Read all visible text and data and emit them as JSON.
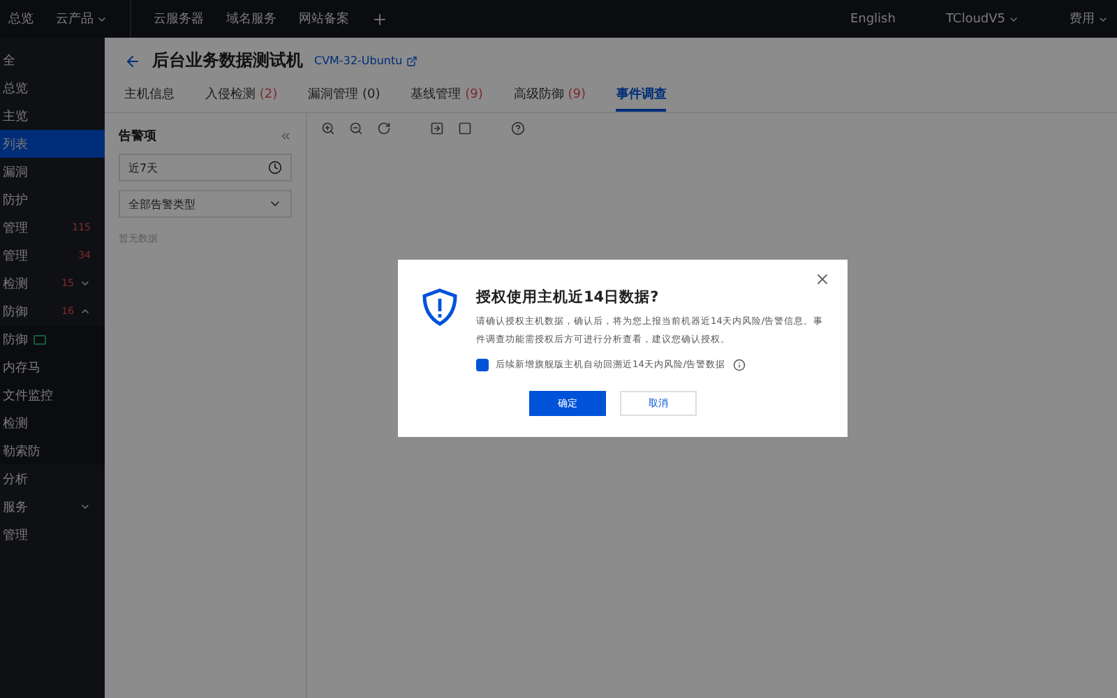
{
  "top_bar": {
    "left_items": [
      {
        "label": "总览",
        "chevron": false
      },
      {
        "label": "云产品",
        "chevron": true
      }
    ],
    "links": [
      "云服务器",
      "域名服务",
      "网站备案"
    ],
    "right_items": [
      {
        "label": "English",
        "chevron": false
      },
      {
        "label": "TCloudV5",
        "chevron": true
      },
      {
        "label": "费用",
        "chevron": true
      }
    ]
  },
  "sidebar": {
    "items": [
      {
        "label": "全",
        "selected": false
      },
      {
        "label": "总览",
        "selected": false
      },
      {
        "label": "主览",
        "selected": false
      },
      {
        "label": "列表",
        "selected": true
      },
      {
        "label": "漏洞",
        "selected": false
      },
      {
        "label": "防护",
        "selected": false
      },
      {
        "label": "管理",
        "selected": false,
        "badge": "115"
      },
      {
        "label": "管理",
        "selected": false,
        "badge": "34"
      },
      {
        "label": "检测",
        "selected": false,
        "badge": "15",
        "expanded": false
      },
      {
        "label": "防御",
        "selected": false,
        "badge": "16",
        "expanded": true,
        "children": [
          {
            "label": "防御",
            "selected": false,
            "tag_icon": true
          },
          {
            "label": "内存马",
            "selected": false
          },
          {
            "label": "文件监控",
            "selected": false
          },
          {
            "label": "检测",
            "selected": false
          },
          {
            "label": "勒索防",
            "selected": false
          }
        ]
      },
      {
        "label": "分析",
        "selected": false
      },
      {
        "label": "服务",
        "selected": false,
        "expanded": false
      },
      {
        "label": "管理",
        "selected": false
      }
    ]
  },
  "page": {
    "title": "后台业务数据测试机",
    "instance": "CVM-32-Ubuntu",
    "tabs": [
      {
        "label": "主机信息",
        "selected": false
      },
      {
        "label": "入侵检测",
        "count": "(2)",
        "selected": false
      },
      {
        "label": "漏洞管理 (0)",
        "selected": false
      },
      {
        "label": "基线管理",
        "count": "(9)",
        "selected": false
      },
      {
        "label": "高级防御",
        "count": "(9)",
        "selected": false
      },
      {
        "label": "事件调查",
        "selected": true
      }
    ],
    "alert_panel": {
      "title": "告警项",
      "time_range": "近7天",
      "alert_type": "全部告警类型",
      "empty_text": "暂无数据"
    }
  },
  "dialog": {
    "title": "授权使用主机近14日数据?",
    "message": "请确认授权主机数据，确认后，将为您上报当前机器近14天内风险/告警信息。事件调查功能需授权后方可进行分析查看，建议您确认授权。",
    "checkbox": {
      "label": "后续新增旗舰版主机自动回溯近14天内风险/告警数据",
      "checked": true
    },
    "confirm": "确定",
    "cancel": "取消"
  }
}
